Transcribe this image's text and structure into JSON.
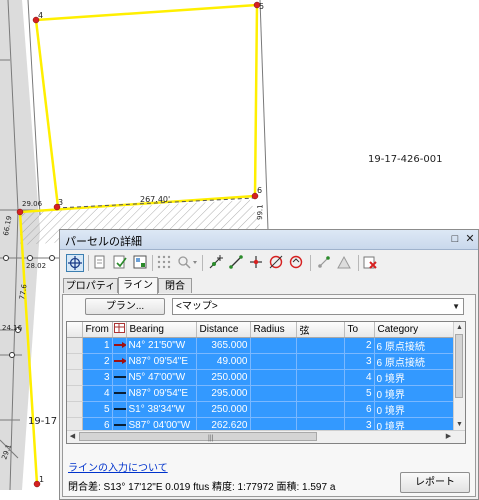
{
  "map": {
    "parcel_label": "19-17-426-001",
    "partial_label": "19-17",
    "dimension_label": "267.40'",
    "points": [
      "4",
      "5",
      "6",
      "3",
      "1"
    ],
    "side_labels": [
      "29.06",
      "28.02",
      "66.19",
      "99.1",
      "77.6",
      "29.1",
      "24.16"
    ]
  },
  "panel": {
    "title": "パーセルの詳細",
    "title_buttons": [
      "□",
      "✕"
    ],
    "tabs": [
      "プロパティ",
      "ライン",
      "閉合"
    ],
    "plan_button": "プラン...",
    "map_select": "<マップ>",
    "columns": [
      "From",
      "",
      "Bearing",
      "Distance",
      "Radius",
      "弦",
      "To",
      "Category"
    ],
    "rows": [
      {
        "from": "1",
        "icon": "arrow-red",
        "bearing": "N4° 21'50\"W",
        "distance": "365.000",
        "radius": "",
        "chord": "",
        "to": "2",
        "category": "6 原点接続"
      },
      {
        "from": "2",
        "icon": "arrow-red",
        "bearing": "N87° 09'54\"E",
        "distance": "49.000",
        "radius": "",
        "chord": "",
        "to": "3",
        "category": "6 原点接続"
      },
      {
        "from": "3",
        "icon": "line-black",
        "bearing": "N5° 47'00\"W",
        "distance": "250.000",
        "radius": "",
        "chord": "",
        "to": "4",
        "category": "0 境界"
      },
      {
        "from": "4",
        "icon": "line-black",
        "bearing": "N87° 09'54\"E",
        "distance": "295.000",
        "radius": "",
        "chord": "",
        "to": "5",
        "category": "0 境界"
      },
      {
        "from": "5",
        "icon": "line-black",
        "bearing": "S1° 38'34\"W",
        "distance": "250.000",
        "radius": "",
        "chord": "",
        "to": "6",
        "category": "0 境界"
      },
      {
        "from": "6",
        "icon": "line-black",
        "bearing": "S87° 04'00\"W",
        "distance": "262.620",
        "radius": "",
        "chord": "",
        "to": "3",
        "category": "0 境界"
      },
      {
        "from": "",
        "icon": "line-black",
        "bearing": "",
        "distance": "",
        "radius": "",
        "chord": "",
        "to": "",
        "category": "0 境界"
      }
    ],
    "help_link": "ラインの入力について",
    "status": "閉合差: S13°  17'12\"E 0.019 ftus  精度: 1:77972  面積: 1.597 a",
    "report_button": "レポート"
  },
  "colors": {
    "parcel_outline": "#ffef00",
    "selection": "#3399ff",
    "point": "#d62020"
  }
}
